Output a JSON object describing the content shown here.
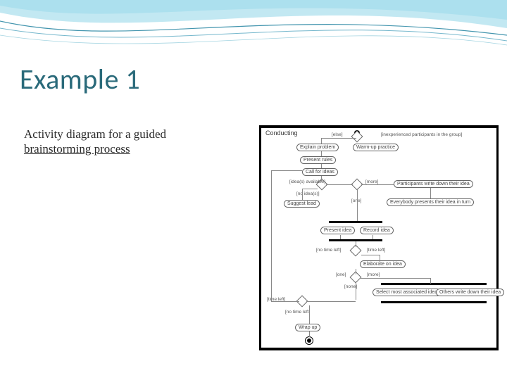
{
  "title": "Example 1",
  "caption": {
    "line1": "Activity diagram for a guided ",
    "link": "brainstorming process"
  },
  "diagram": {
    "frame_label": "Conducting",
    "start": true,
    "end": true,
    "guards": {
      "else": "[else]",
      "inexperienced": "[inexperienced participants in the group]",
      "ideas_avail": "[idea(s) available]",
      "more1": "[more]",
      "no_ideas": "[no idea(s)]",
      "one1": "[one]",
      "no_time1": "[no time left]",
      "time_left1": "[time left]",
      "one2": "[one]",
      "more2": "[more]",
      "none": "[none]",
      "time_left2": "[time left]",
      "no_time2": "[no time left]"
    },
    "nodes": {
      "explain": "Explain problem",
      "warmup": "Warm-up practice",
      "present_rules": "Present rules",
      "call_ideas": "Call for ideas",
      "suggest_lead": "Suggest lead",
      "participants_write": "Participants write down their idea",
      "everybody_presents": "Everybody presents their idea in turn",
      "present_idea": "Present idea",
      "record_idea": "Record idea",
      "elaborate": "Elaborate on idea",
      "select_most": "Select most associated idea",
      "others_write": "Others write down their idea",
      "wrapup": "Wrap up"
    }
  }
}
